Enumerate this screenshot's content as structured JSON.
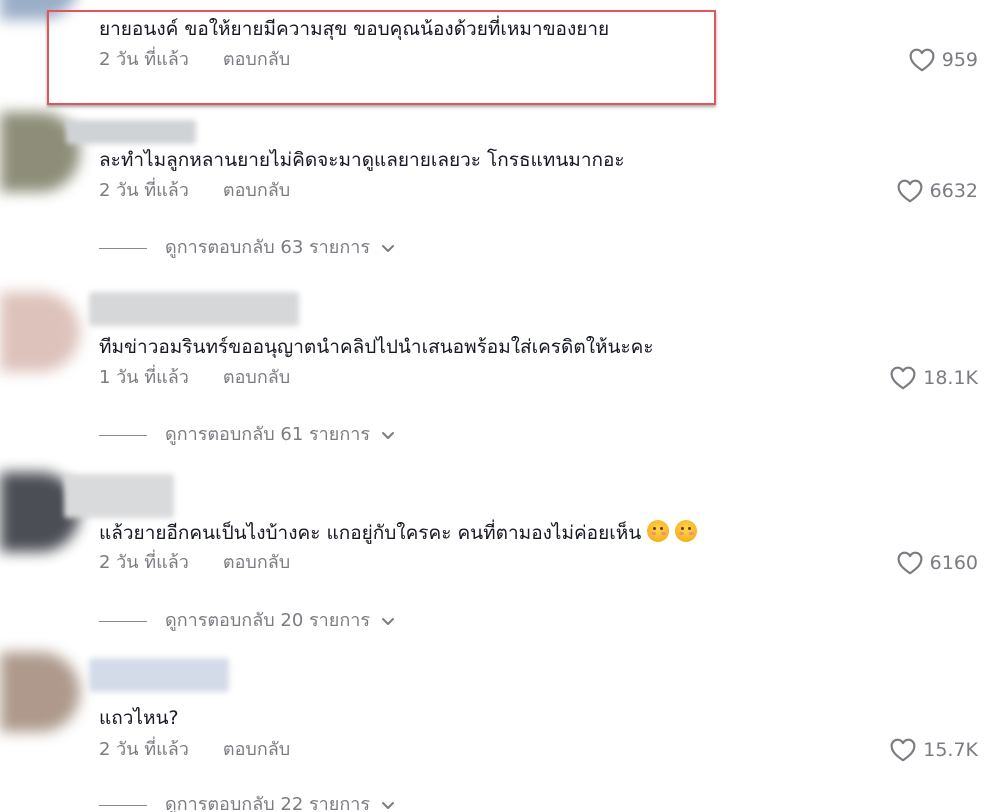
{
  "comments": [
    {
      "text": "ยายอนงค์ ขอให้ยายมีความสุข ขอบคุณน้องด้วยที่เหมาของยาย",
      "time": "2 วัน ที่แล้ว",
      "reply_label": "ตอบกลับ",
      "likes": "959"
    },
    {
      "text": "ละทำไมลูกหลานยายไม่คิดจะมาดูแลยายเลยวะ โกรธแทนมากอะ",
      "time": "2 วัน ที่แล้ว",
      "reply_label": "ตอบกลับ",
      "likes": "6632",
      "view_replies": "ดูการตอบกลับ 63 รายการ"
    },
    {
      "text": "ทีมข่าวอมรินทร์ขออนุญาตนำคลิปไปนำเสนอพร้อมใส่เครดิตให้นะคะ",
      "time": "1 วัน ที่แล้ว",
      "reply_label": "ตอบกลับ",
      "likes": "18.1K",
      "view_replies": "ดูการตอบกลับ 61 รายการ"
    },
    {
      "text": "แล้วยายอีกคนเป็นไงบ้างคะ แกอยู่กับใครคะ คนที่ตามองไม่ค่อยเห็น",
      "emojis": [
        "pleading-face-emoji",
        "pleading-face-emoji"
      ],
      "time": "2 วัน ที่แล้ว",
      "reply_label": "ตอบกลับ",
      "likes": "6160",
      "view_replies": "ดูการตอบกลับ 20 รายการ"
    },
    {
      "text": "แถวไหน?",
      "time": "2 วัน ที่แล้ว",
      "reply_label": "ตอบกลับ",
      "likes": "15.7K",
      "view_replies": "ดูการตอบกลับ 22 รายการ"
    }
  ],
  "icons": {
    "like": "heart-outline-icon",
    "expand": "chevron-down-icon"
  },
  "colors": {
    "text": "#161823",
    "secondary": "#7b7c82",
    "highlight_border": "#e0565b"
  }
}
